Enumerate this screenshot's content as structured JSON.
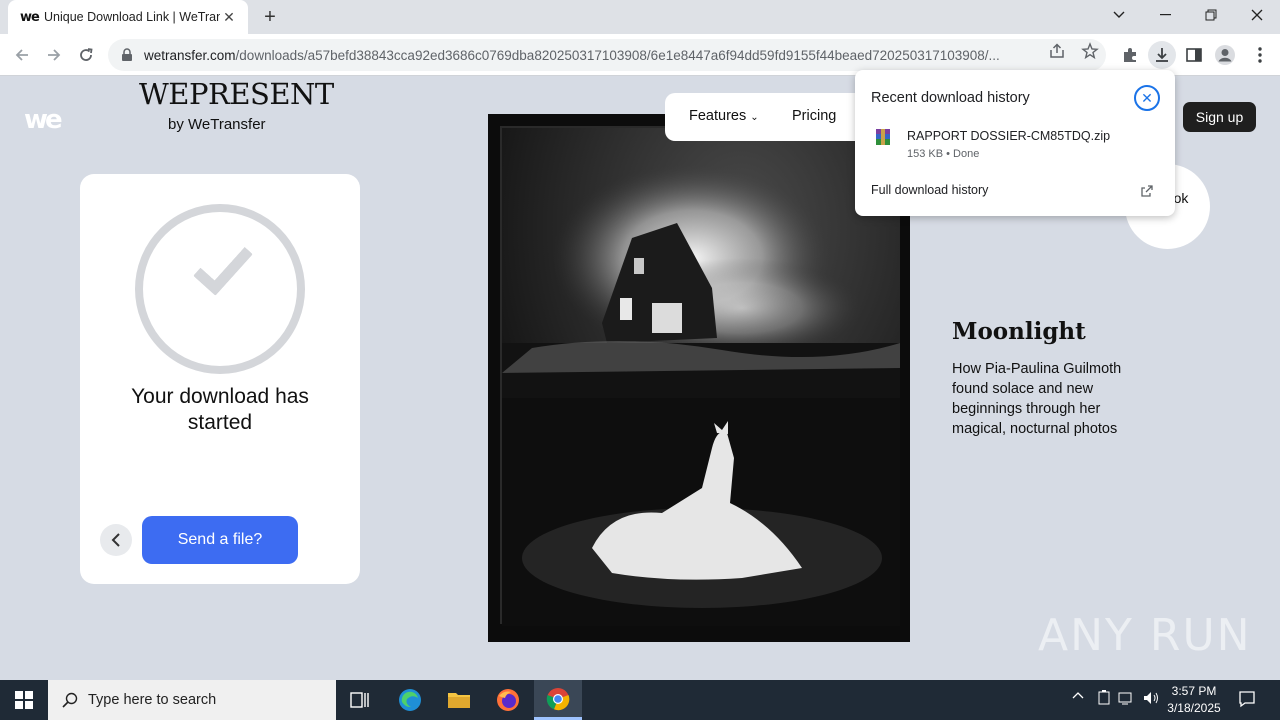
{
  "browser": {
    "tab_title": "Unique Download Link | WeTran",
    "tab_favicon": "we",
    "url_host": "wetransfer.com",
    "url_path": "/downloads/a57befd38843cca92ed3686c0769dba820250317103908/6e1e8447a6f94dd59fd9155f44beaed720250317103908/..."
  },
  "page": {
    "logo": "we",
    "wepresent": "WEPRESENT",
    "by_wetransfer": "by WeTransfer",
    "card_title": "Your download has started",
    "send_button": "Send a file?",
    "nav": {
      "features": "Features",
      "pricing": "Pricing",
      "signup": "Sign up"
    },
    "take_a_look": "a look",
    "story_title": "Moonlight",
    "story_desc": "How Pia-Paulina Guilmoth found solace and new beginnings through her magical, nocturnal photos"
  },
  "downloads": {
    "header": "Recent download history",
    "file_name": "RAPPORT DOSSIER-CM85TDQ.zip",
    "file_meta": "153 KB • Done",
    "full_history": "Full download history"
  },
  "watermark": "ANY RUN",
  "taskbar": {
    "search_placeholder": "Type here to search",
    "time": "3:57 PM",
    "date": "3/18/2025"
  }
}
